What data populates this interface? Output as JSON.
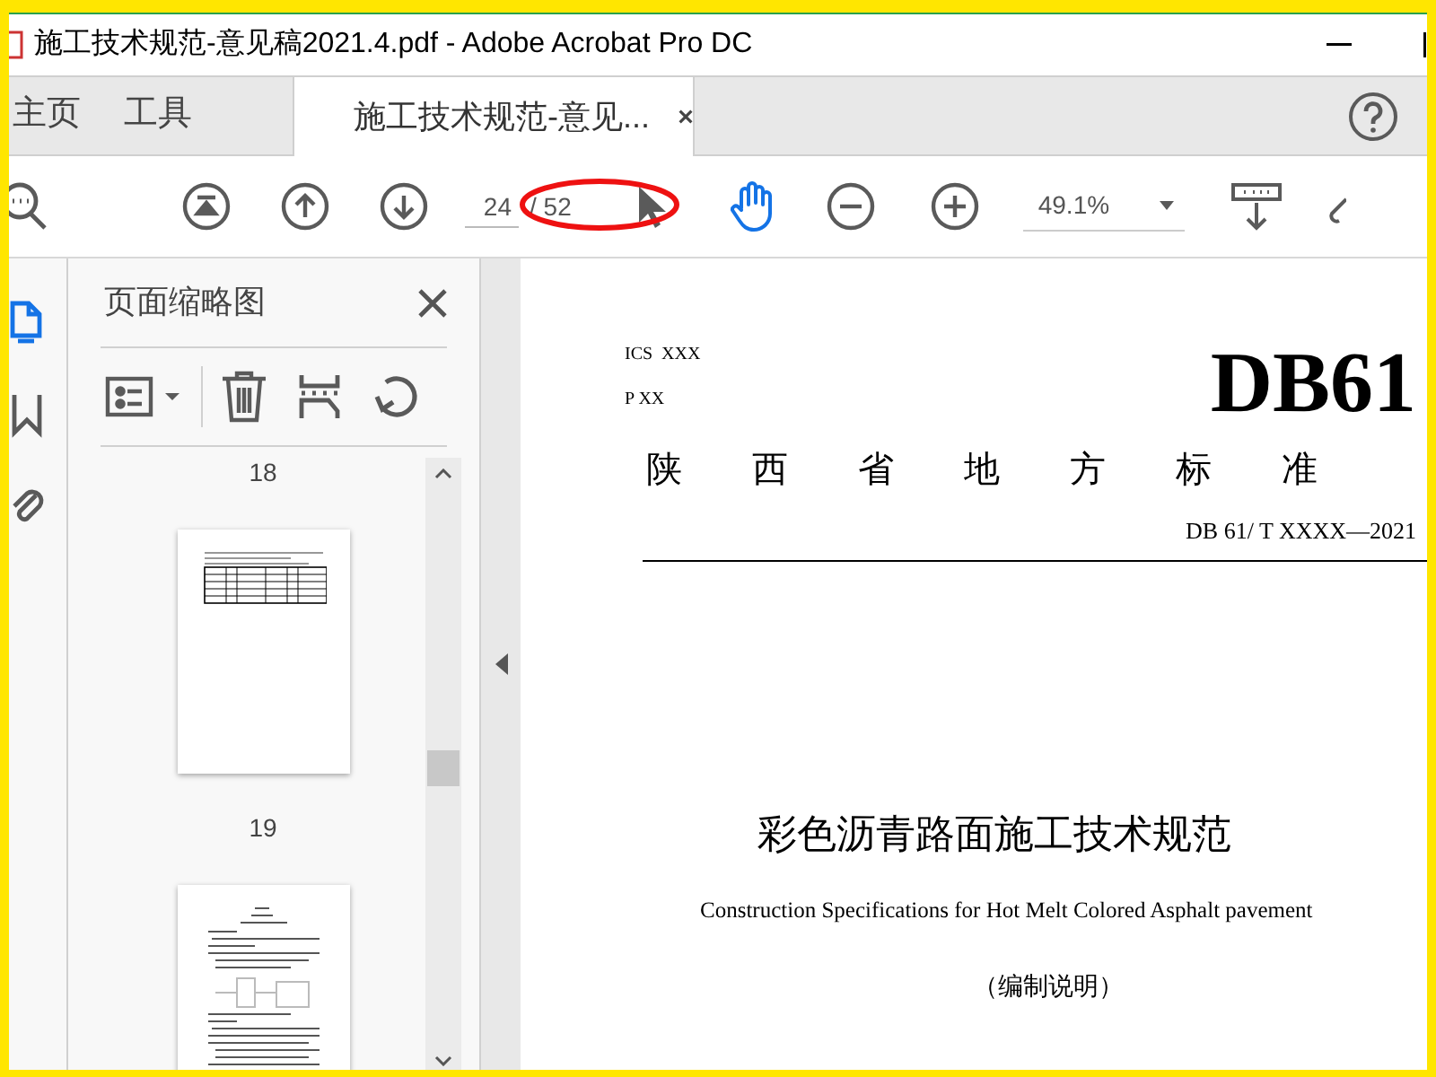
{
  "window": {
    "title": "施工技术规范-意见稿2021.4.pdf - Adobe Acrobat Pro DC"
  },
  "tabs": [
    {
      "label": "主页",
      "selected": false,
      "closable": false
    },
    {
      "label": "工具",
      "selected": false,
      "closable": false
    },
    {
      "label": "施工技术规范-意见...",
      "selected": true,
      "closable": true
    }
  ],
  "toolbar": {
    "page_current": "24",
    "page_total": "/ 52",
    "zoom": "49.1%",
    "tools": [
      {
        "kind": "select",
        "selected": false
      },
      {
        "kind": "hand",
        "selected": true
      }
    ]
  },
  "side_icons": [
    {
      "kind": "pages",
      "selected": true
    },
    {
      "kind": "bookmark",
      "selected": false
    },
    {
      "kind": "attachment",
      "selected": false
    }
  ],
  "panel": {
    "title": "页面缩略图",
    "thumbnails": [
      {
        "label": "18",
        "kind": "table"
      },
      {
        "label": "19",
        "kind": "text"
      }
    ]
  },
  "document": {
    "ics": "ICS  XXX",
    "p": "P XX",
    "code": "DB61",
    "org": "陕西省地方标准",
    "number": "DB 61/ T XXXX—2021",
    "title": "彩色沥青路面施工技术规范",
    "subtitle": "Construction Specifications for Hot Melt Colored Asphalt pavement",
    "note": "（编制说明）"
  }
}
